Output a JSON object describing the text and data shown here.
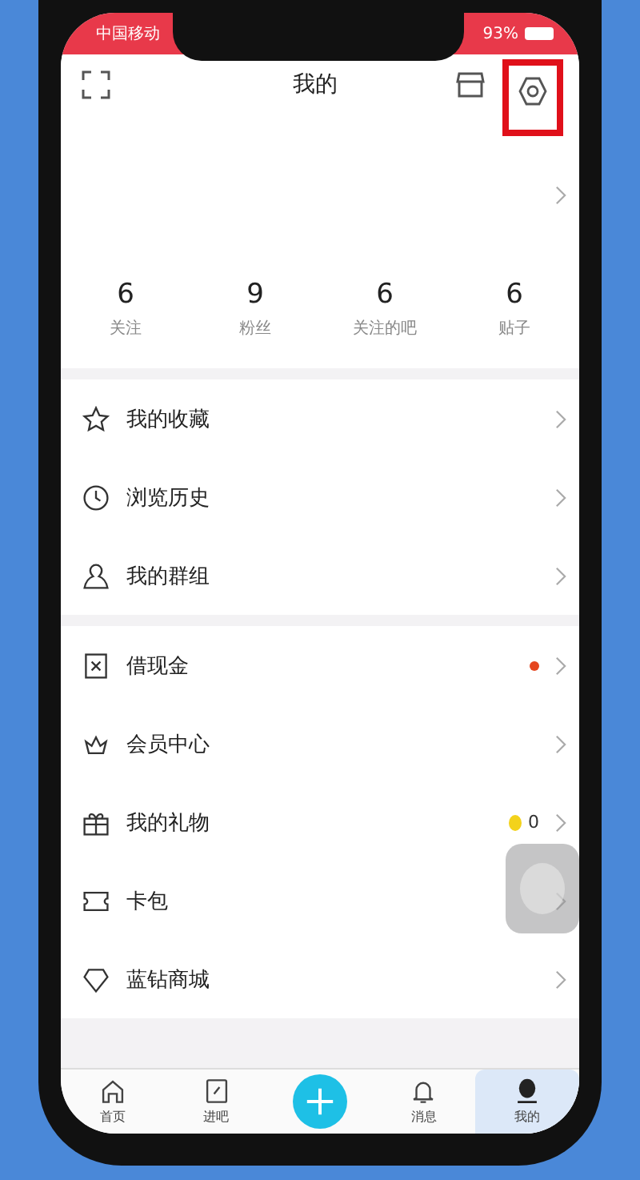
{
  "status_bar": {
    "carrier": "中国移动",
    "battery": "93%"
  },
  "header": {
    "title": "我的"
  },
  "stats": [
    {
      "value": "6",
      "label": "关注"
    },
    {
      "value": "9",
      "label": "粉丝"
    },
    {
      "value": "6",
      "label": "关注的吧"
    },
    {
      "value": "6",
      "label": "贴子"
    }
  ],
  "menu_groups": [
    [
      {
        "label": "我的收藏",
        "kind": "plain"
      },
      {
        "label": "浏览历史",
        "kind": "plain"
      },
      {
        "label": "我的群组",
        "kind": "plain"
      }
    ],
    [
      {
        "label": "借现金",
        "kind": "dot"
      },
      {
        "label": "会员中心",
        "kind": "plain"
      },
      {
        "label": "我的礼物",
        "kind": "coin",
        "count": "0"
      },
      {
        "label": "卡包",
        "kind": "plain"
      },
      {
        "label": "蓝钻商城",
        "kind": "plain"
      }
    ]
  ],
  "tabs": [
    {
      "label": "首页",
      "selected": false
    },
    {
      "label": "进吧",
      "selected": false
    },
    {
      "label": "消息",
      "selected": false
    },
    {
      "label": "我的",
      "selected": true
    }
  ]
}
